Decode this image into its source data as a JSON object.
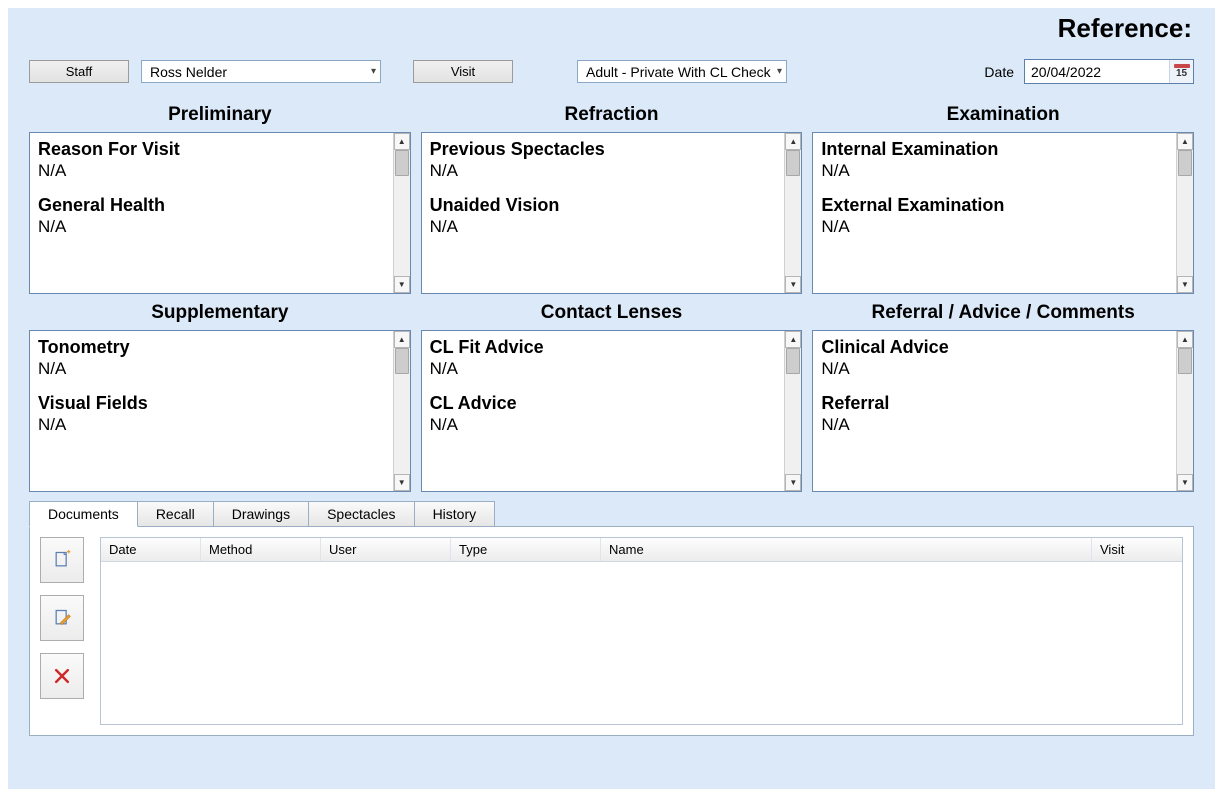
{
  "header": {
    "reference_label": "Reference:"
  },
  "toolbar": {
    "staff_btn": "Staff",
    "staff_value": "Ross Nelder",
    "visit_btn": "Visit",
    "visit_value": "Adult - Private With CL Check",
    "date_label": "Date",
    "date_value": "20/04/2022",
    "cal_day": "15"
  },
  "sections": {
    "preliminary": {
      "title": "Preliminary",
      "items": [
        {
          "h": "Reason For Visit",
          "v": "N/A"
        },
        {
          "h": "General Health",
          "v": "N/A"
        }
      ]
    },
    "refraction": {
      "title": "Refraction",
      "items": [
        {
          "h": "Previous Spectacles",
          "v": "N/A"
        },
        {
          "h": "Unaided Vision",
          "v": "N/A"
        }
      ]
    },
    "examination": {
      "title": "Examination",
      "items": [
        {
          "h": "Internal Examination",
          "v": "N/A"
        },
        {
          "h": "External Examination",
          "v": "N/A"
        }
      ]
    },
    "supplementary": {
      "title": "Supplementary",
      "items": [
        {
          "h": "Tonometry",
          "v": "N/A"
        },
        {
          "h": "Visual Fields",
          "v": "N/A"
        }
      ]
    },
    "contactlenses": {
      "title": "Contact Lenses",
      "items": [
        {
          "h": "CL Fit Advice",
          "v": "N/A"
        },
        {
          "h": "CL Advice",
          "v": "N/A"
        }
      ]
    },
    "referral": {
      "title": "Referral / Advice / Comments",
      "items": [
        {
          "h": "Clinical Advice",
          "v": "N/A"
        },
        {
          "h": "Referral",
          "v": "N/A"
        }
      ]
    }
  },
  "tabs": {
    "items": [
      "Documents",
      "Recall",
      "Drawings",
      "Spectacles",
      "History"
    ],
    "active": "Documents"
  },
  "grid": {
    "columns": [
      "Date",
      "Method",
      "User",
      "Type",
      "Name",
      "Visit"
    ]
  }
}
